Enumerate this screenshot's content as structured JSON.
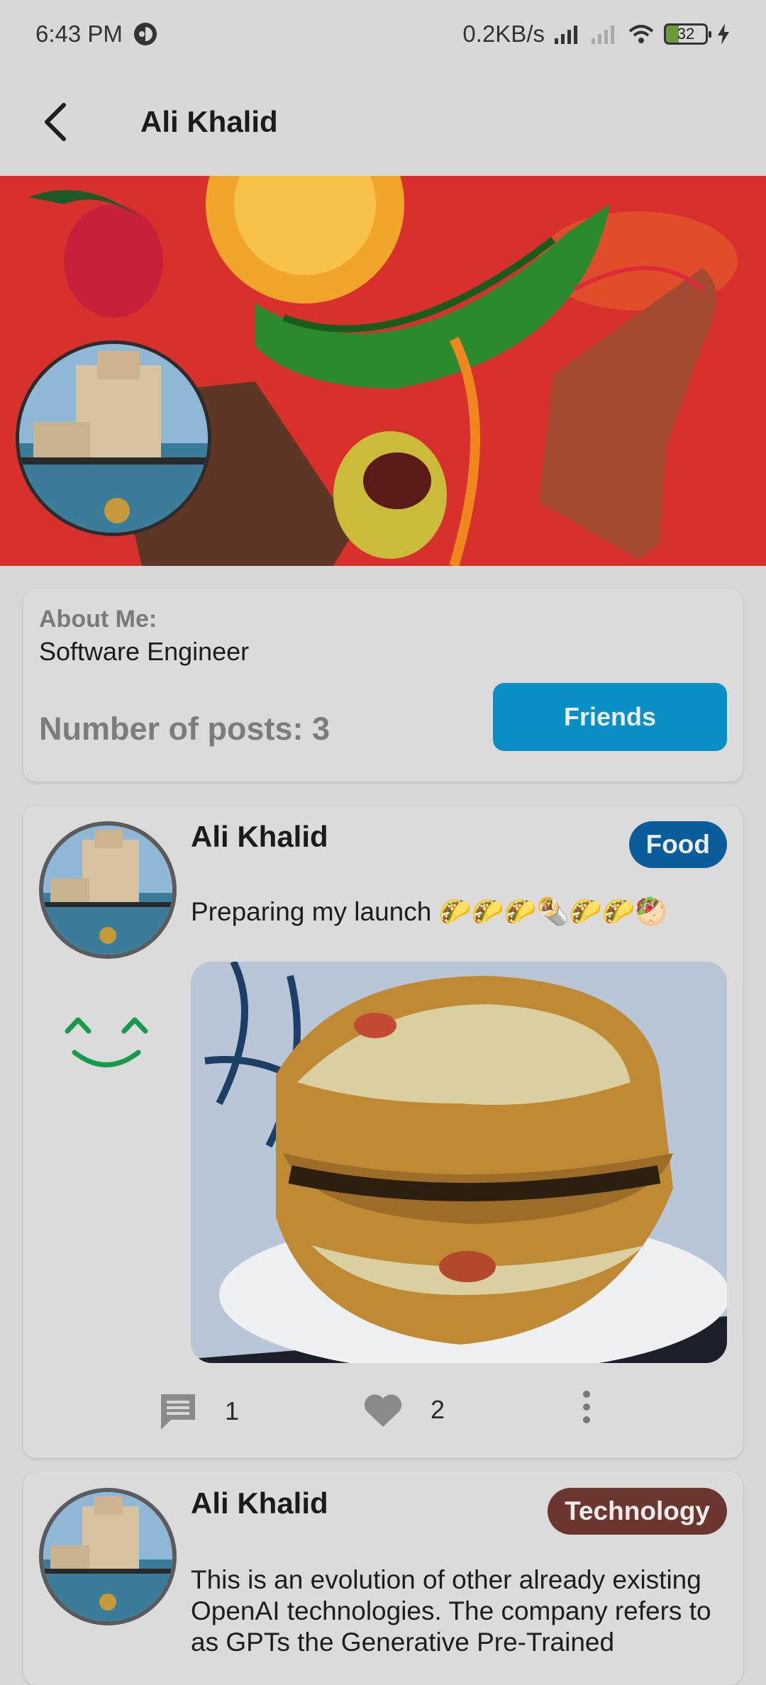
{
  "status": {
    "time": "6:43 PM",
    "speed": "0.2KB/s",
    "battery": "32"
  },
  "appbar": {
    "title": "Ali Khalid"
  },
  "about": {
    "label": "About Me:",
    "value": "Software Engineer",
    "posts_count": "Number of posts: 3",
    "friends_label": "Friends"
  },
  "posts": [
    {
      "author": "Ali Khalid",
      "category": "Food",
      "category_color": "#0b5c9b",
      "text": "Preparing my launch 🌮🌮🌮🌯🌮🌮🥙",
      "comments": "1",
      "likes": "2"
    },
    {
      "author": "Ali Khalid",
      "category": "Technology",
      "category_color": "#6b3530",
      "text": "This is an evolution of other already existing OpenAI technologies. The company refers to as GPTs the Generative Pre-Trained"
    }
  ],
  "colors": {
    "accent": "#0a8fc4",
    "background": "#d9d8d8",
    "mood": "#169a4c"
  }
}
